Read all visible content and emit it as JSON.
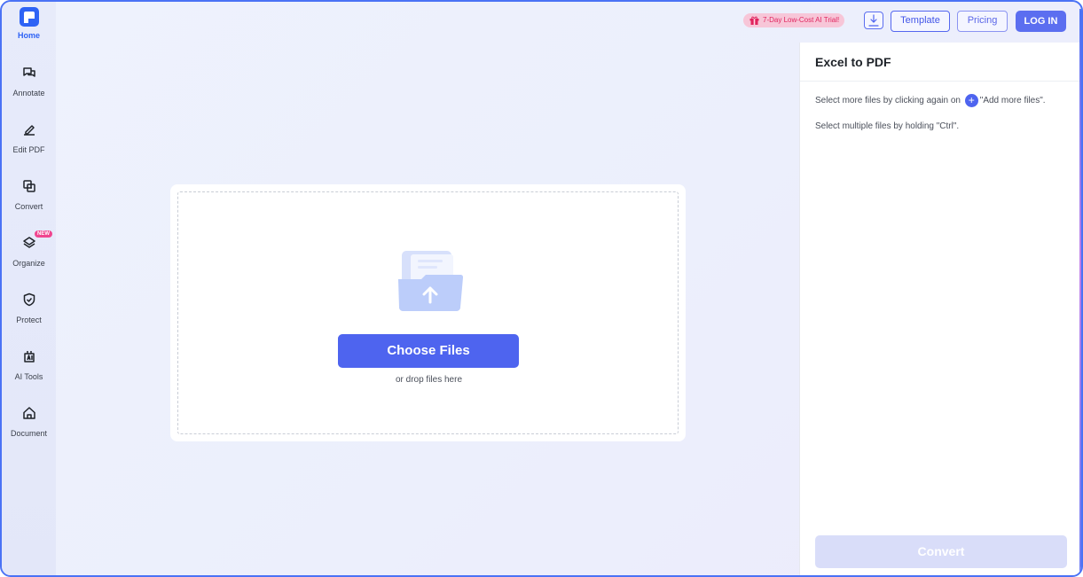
{
  "sidebar": {
    "home_label": "Home",
    "items": [
      {
        "label": "Annotate",
        "icon": "annotate-icon"
      },
      {
        "label": "Edit PDF",
        "icon": "edit-pdf-icon"
      },
      {
        "label": "Convert",
        "icon": "convert-icon"
      },
      {
        "label": "Organize",
        "icon": "organize-icon",
        "badge": "NEW"
      },
      {
        "label": "Protect",
        "icon": "protect-icon"
      },
      {
        "label": "AI Tools",
        "icon": "ai-tools-icon"
      },
      {
        "label": "Document",
        "icon": "document-icon"
      }
    ]
  },
  "topbar": {
    "promo_text": "7-Day Low-Cost AI Trial!",
    "template_label": "Template",
    "pricing_label": "Pricing",
    "login_label": "LOG IN"
  },
  "upload": {
    "choose_label": "Choose Files",
    "drop_text": "or drop files here"
  },
  "panel": {
    "title": "Excel to PDF",
    "hint1_before": "Select more files by clicking again on",
    "hint1_after": "\"Add more files\".",
    "hint2": "Select multiple files by holding \"Ctrl\".",
    "convert_label": "Convert"
  },
  "colors": {
    "accent": "#4e64ef",
    "brand": "#2e63f5",
    "promo_text": "#e0245e",
    "new_badge": "#f0458f"
  }
}
